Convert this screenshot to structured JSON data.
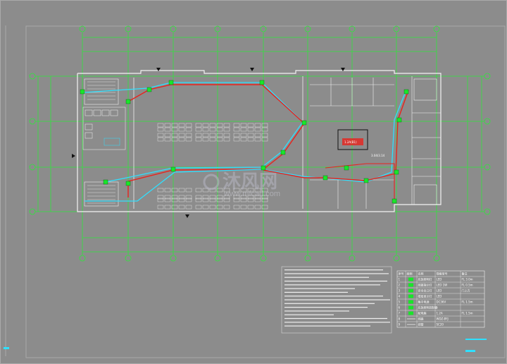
{
  "drawing": {
    "background": "#8c8c8c",
    "colors": {
      "grid": "#2ee83a",
      "wall": "#f2f2f2",
      "pipe_red": "#e8231d",
      "pipe_cyan": "#2fe0ff",
      "device": "#19e62a"
    }
  },
  "watermark": {
    "brand": "沐风网",
    "url": "www.mfcad.com"
  },
  "callouts": {
    "panel_label": "3.04/3.14",
    "box_label": "1.2A(B1)"
  },
  "legend": {
    "headers": [
      "序号",
      "图例",
      "名称",
      "规格型号",
      "备注"
    ],
    "rows": [
      {
        "no": "1",
        "symbol": "green-square",
        "name": "应急照明灯",
        "spec": "LED",
        "note": "FL 3.0m"
      },
      {
        "no": "2",
        "symbol": "green-square",
        "name": "疏散指示灯",
        "spec": "LED 1W",
        "note": "FL 0.5m"
      },
      {
        "no": "3",
        "symbol": "green-square",
        "name": "安全出口灯",
        "spec": "LED",
        "note": "门上方"
      },
      {
        "no": "4",
        "symbol": "green-square",
        "name": "楼层显示灯",
        "spec": "LED",
        "note": ""
      },
      {
        "no": "5",
        "symbol": "green-square",
        "name": "集中电源",
        "spec": "DC36V",
        "note": "FL 1.5m"
      },
      {
        "no": "6",
        "symbol": "green-square",
        "name": "应急照明控制器",
        "spec": "",
        "note": ""
      },
      {
        "no": "7",
        "symbol": "green-square",
        "name": "配电箱",
        "spec": "1.2A",
        "note": "FL 1.5m"
      },
      {
        "no": "8",
        "symbol": "line",
        "name": "线路",
        "spec": "WDZ-BYJ",
        "note": ""
      },
      {
        "no": "9",
        "symbol": "line",
        "name": "线管",
        "spec": "SC20",
        "note": ""
      }
    ]
  }
}
